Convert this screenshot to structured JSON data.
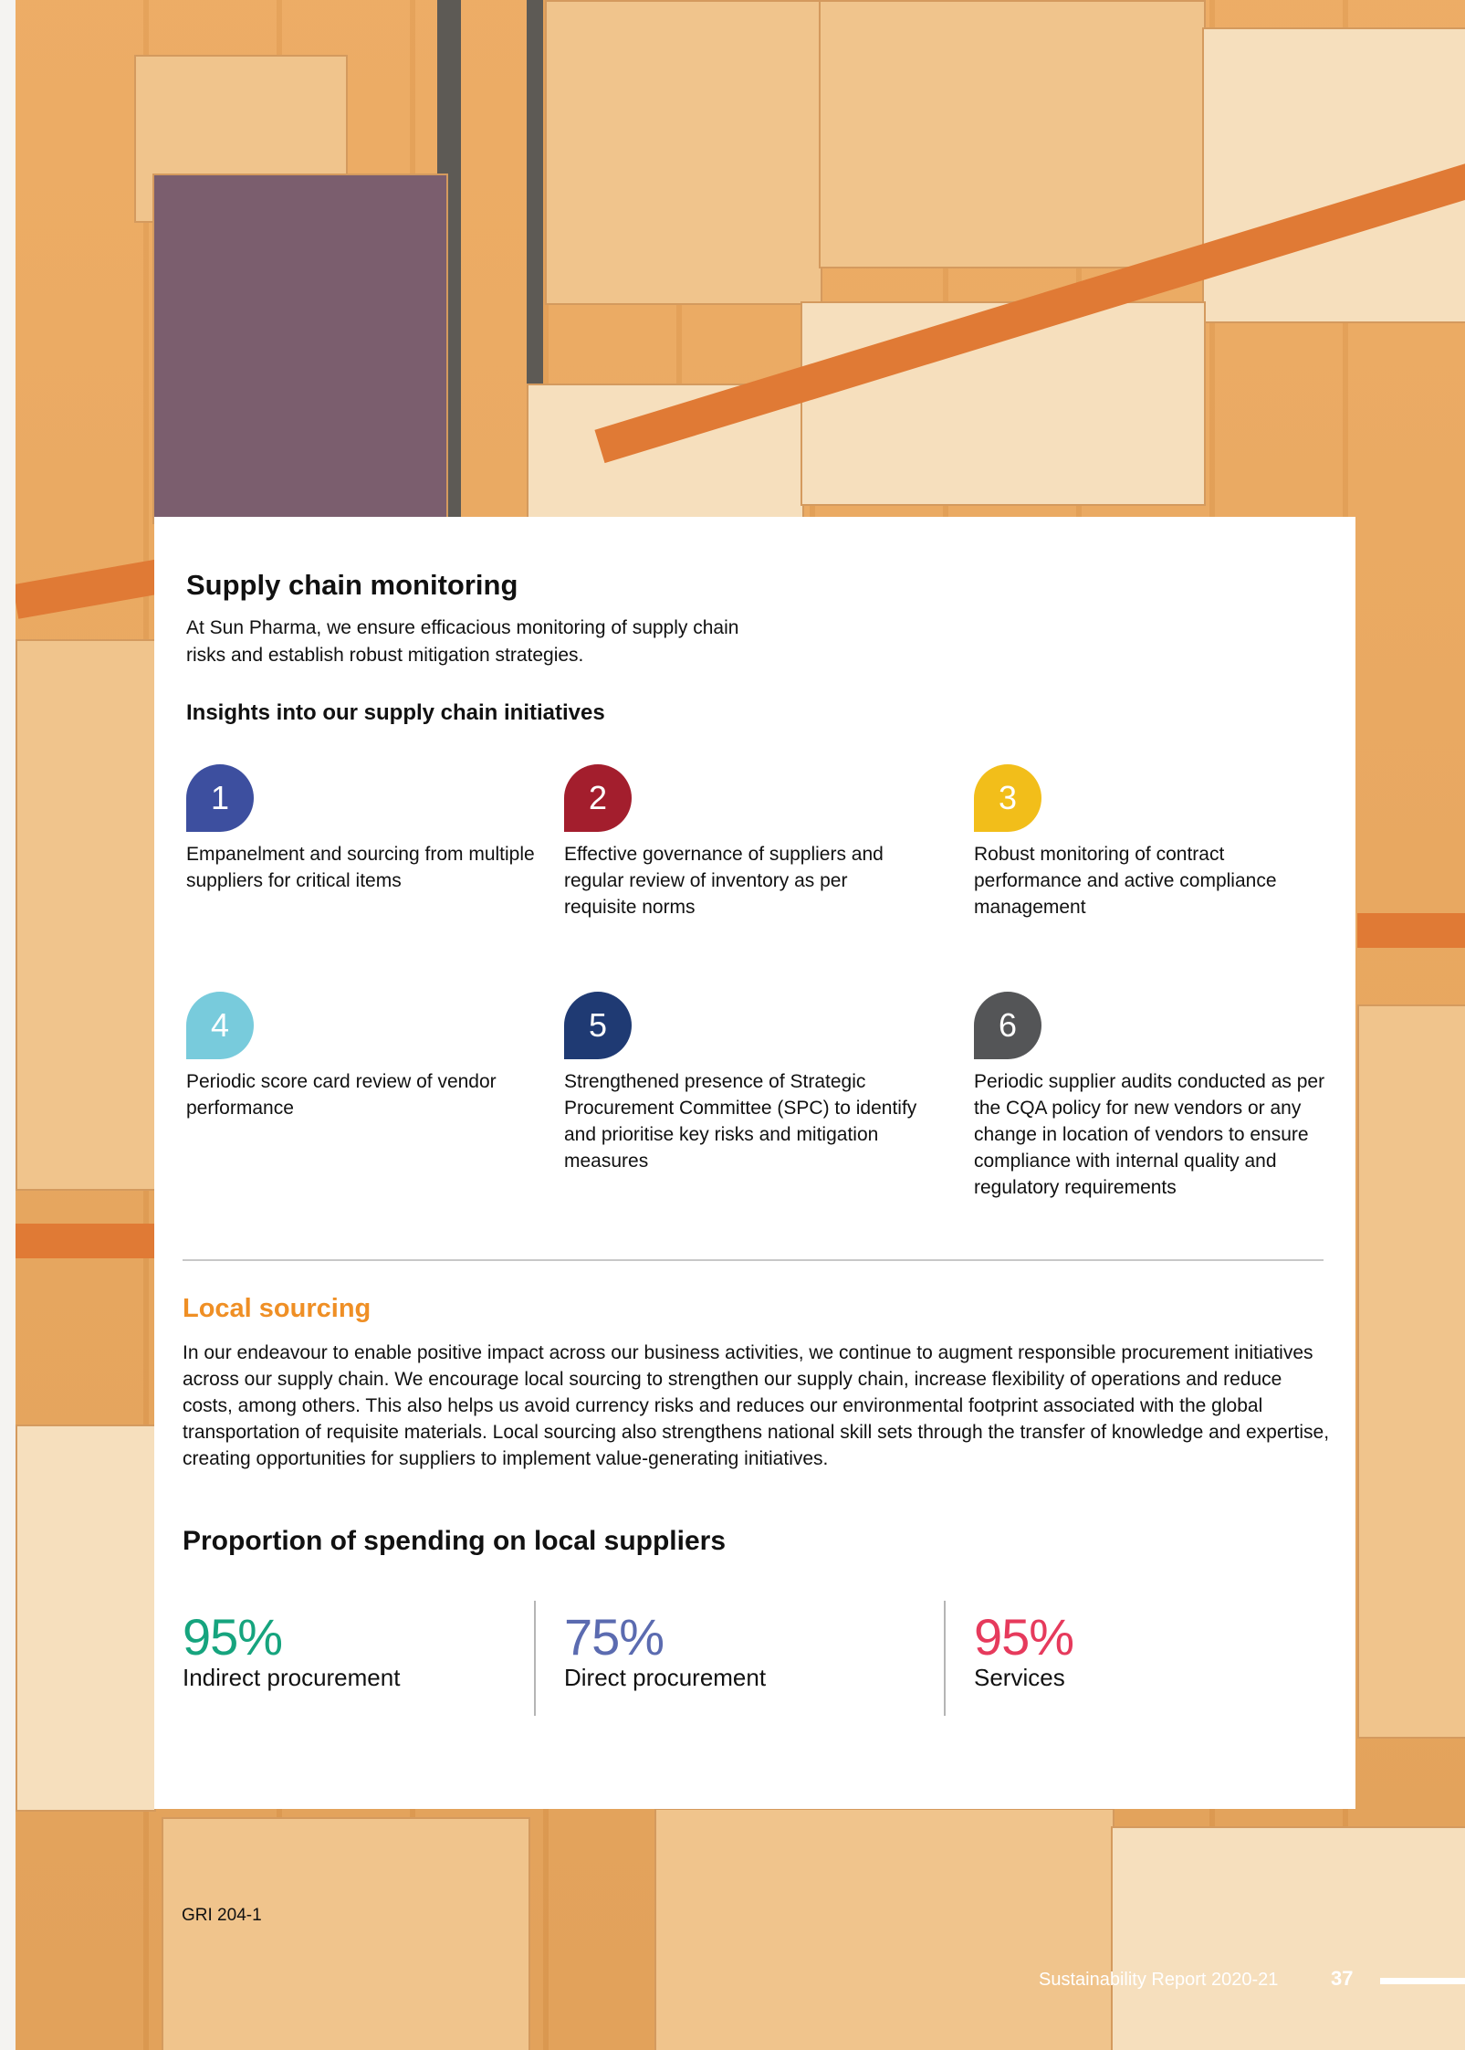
{
  "monitoring": {
    "title": "Supply chain monitoring",
    "intro": "At Sun Pharma, we ensure efficacious monitoring of supply chain risks and establish robust mitigation strategies."
  },
  "insights": {
    "title": "Insights into our supply chain initiatives",
    "items": [
      {
        "number": "1",
        "color": "#3d4f9f",
        "text": "Empanelment and sourcing from multiple suppliers for critical items"
      },
      {
        "number": "2",
        "color": "#a31e2d",
        "text": "Effective governance of suppliers and regular review of inventory as per requisite norms"
      },
      {
        "number": "3",
        "color": "#f2be1a",
        "text": "Robust monitoring of contract performance and active compliance management"
      },
      {
        "number": "4",
        "color": "#78cbdc",
        "text": "Periodic score card review of vendor performance"
      },
      {
        "number": "5",
        "color": "#1f3a73",
        "text": "Strengthened presence of Strategic Procurement Committee (SPC) to identify and prioritise key risks and mitigation measures"
      },
      {
        "number": "6",
        "color": "#545557",
        "text": "Periodic supplier audits conducted as per the CQA policy for new vendors or any change in location of vendors to ensure compliance with internal quality and regulatory requirements"
      }
    ]
  },
  "local_sourcing": {
    "title": "Local sourcing",
    "color": "#ef8f25",
    "paragraph": "In our endeavour to enable positive impact across our business activities, we continue to augment responsible procurement initiatives across our supply chain. We encourage local sourcing to strengthen our supply chain, increase flexibility of operations and reduce costs, among others. This also helps us avoid currency risks and reduces our environmental footprint associated with the global transportation of requisite materials. Local sourcing also strengthens national skill sets through the transfer of knowledge and expertise, creating opportunities for suppliers to implement value-generating initiatives."
  },
  "spending": {
    "title": "Proportion of spending on local suppliers",
    "stats": [
      {
        "value": "95%",
        "label": "Indirect procurement",
        "color": "#16a47e"
      },
      {
        "value": "75%",
        "label": "Direct procurement",
        "color": "#5b6bb0"
      },
      {
        "value": "95%",
        "label": "Services",
        "color": "#e63a5c"
      }
    ]
  },
  "footer": {
    "gri": "GRI 204-1",
    "report": "Sustainability Report 2020-21",
    "page": "37"
  }
}
